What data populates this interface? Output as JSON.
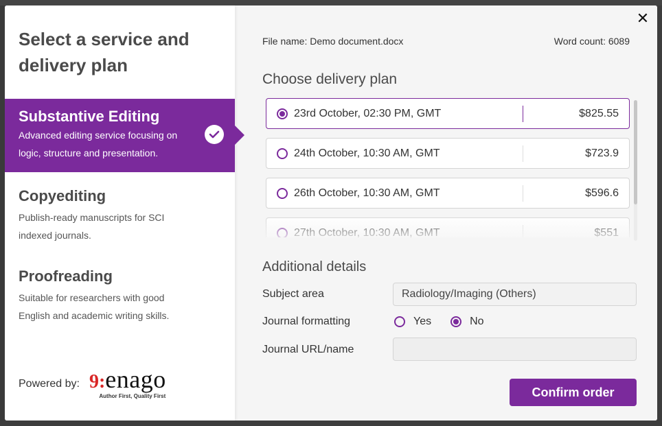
{
  "left_panel": {
    "title": "Select a service and delivery plan",
    "services": [
      {
        "name": "Substantive Editing",
        "description": "Advanced editing service focusing on logic, structure and presentation.",
        "selected": true
      },
      {
        "name": "Copyediting",
        "description": "Publish-ready manuscripts for SCI indexed journals.",
        "selected": false
      },
      {
        "name": "Proofreading",
        "description": "Suitable for researchers with good English and academic writing skills.",
        "selected": false
      }
    ],
    "powered_by_label": "Powered by:",
    "logo": {
      "mark": "9:",
      "name": "enago",
      "tagline": "Author First, Quality First"
    }
  },
  "right_panel": {
    "close_icon": "close-icon",
    "file_name": "File name: Demo document.docx",
    "word_count": "Word count: 6089",
    "delivery_title": "Choose delivery plan",
    "plans": [
      {
        "date": "23rd October, 02:30 PM, GMT",
        "price": "$825.55",
        "selected": true
      },
      {
        "date": "24th October, 10:30 AM, GMT",
        "price": "$723.9",
        "selected": false
      },
      {
        "date": "26th October, 10:30 AM, GMT",
        "price": "$596.6",
        "selected": false
      },
      {
        "date": "27th October, 10:30 AM, GMT",
        "price": "$551",
        "selected": false
      }
    ],
    "details_title": "Additional details",
    "subject_area_label": "Subject area",
    "subject_area_value": "Radiology/Imaging (Others)",
    "journal_formatting_label": "Journal formatting",
    "journal_formatting_options": [
      {
        "label": "Yes",
        "selected": false
      },
      {
        "label": "No",
        "selected": true
      }
    ],
    "journal_url_label": "Journal URL/name",
    "journal_url_value": "",
    "confirm_label": "Confirm order"
  },
  "colors": {
    "accent": "#7b2a9c",
    "left_bg": "#ffffff",
    "right_bg": "#f5f5f5",
    "logo_red": "#d92727"
  }
}
